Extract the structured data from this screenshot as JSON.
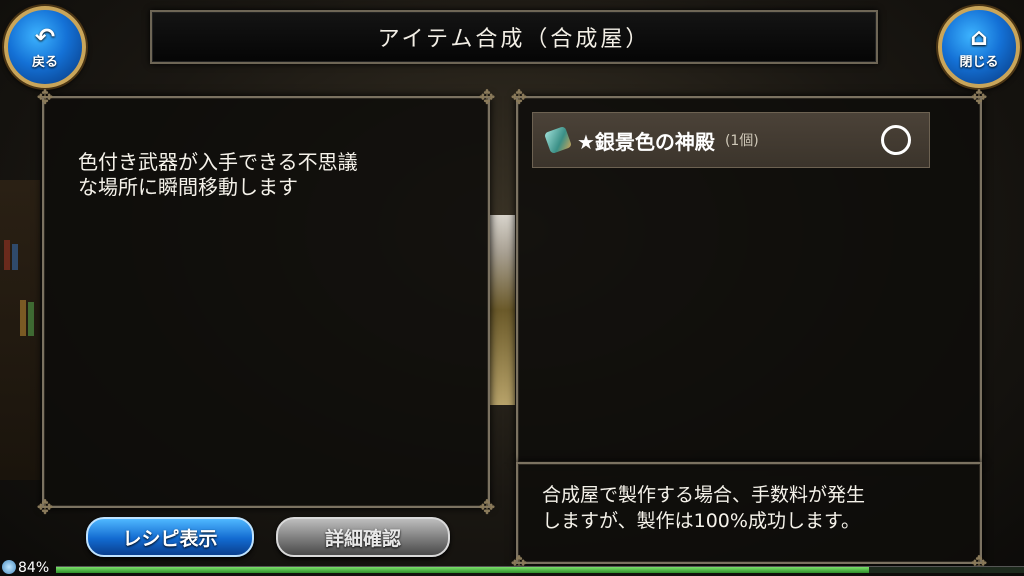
{
  "header": {
    "title": "アイテム合成（合成屋）"
  },
  "nav": {
    "back_label": "戻る",
    "close_label": "閉じる"
  },
  "description": {
    "lines": [
      "色付き武器が入手できる不思議",
      "な場所に瞬間移動します"
    ]
  },
  "item_list": [
    {
      "name": "★銀景色の神殿",
      "count": "(1個)",
      "selected": true,
      "icon": "crystal-item-icon"
    }
  ],
  "info": {
    "lines": [
      "合成屋で製作する場合、手数料が発生",
      "しますが、製作は100%成功します。"
    ]
  },
  "buttons": {
    "recipe_label": "レシピ表示",
    "detail_label": "詳細確認"
  },
  "status": {
    "battery": "84%",
    "battery_level": 0.84
  },
  "colors": {
    "accent_blue": "#1471d6",
    "gold_trim": "#c9a55a",
    "panel_border": "#7b7261"
  }
}
